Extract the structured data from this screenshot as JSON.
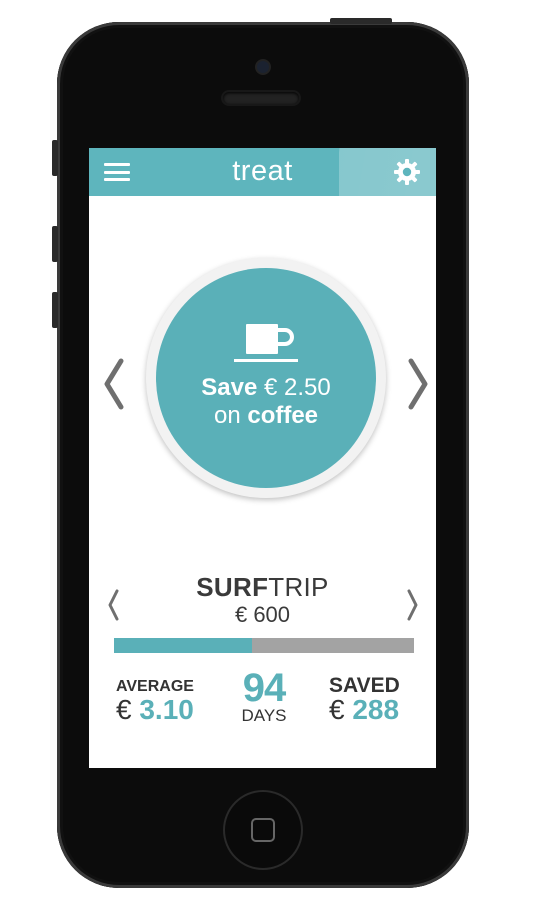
{
  "app": {
    "title": "treat"
  },
  "header": {
    "menu_icon": "hamburger-menu-icon",
    "settings_icon": "gear-icon"
  },
  "treat_card": {
    "icon": "coffee-cup-icon",
    "save_word": "Save",
    "amount": "€ 2.50",
    "on_word": "on",
    "item": "coffee"
  },
  "goal": {
    "name_bold": "SURF",
    "name_rest": "TRIP",
    "amount": "€ 600",
    "progress_fraction": 0.46
  },
  "stats": {
    "average_label": "AVERAGE",
    "average_currency": "€",
    "average_value": "3.10",
    "days_value": "94",
    "days_label": "DAYS",
    "saved_label": "SAVED",
    "saved_currency": "€",
    "saved_value": "288"
  },
  "colors": {
    "accent": "#5ab0b8",
    "header": "#5eb5bd",
    "track": "#a3a3a3",
    "text": "#333333"
  }
}
